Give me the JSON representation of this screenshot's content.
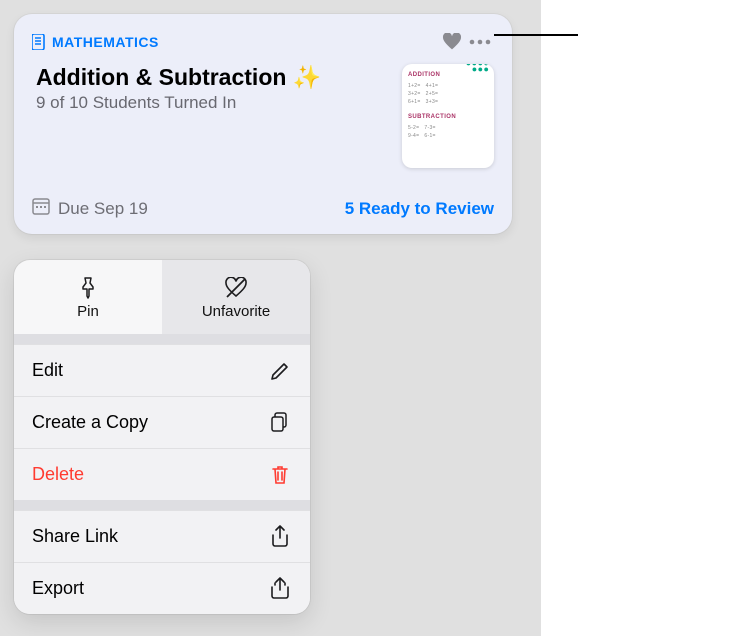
{
  "card": {
    "subject": "MATHEMATICS",
    "title": "Addition & Subtraction ✨",
    "subtitle": "9 of 10 Students Turned In",
    "due": "Due Sep 19",
    "review": "5 Ready to Review"
  },
  "thumbnail": {
    "heading1": "ADDITION",
    "heading2": "SUBTRACTION"
  },
  "menu": {
    "pin": "Pin",
    "unfavorite": "Unfavorite",
    "edit": "Edit",
    "copy": "Create a Copy",
    "delete": "Delete",
    "share": "Share Link",
    "export": "Export"
  },
  "colors": {
    "accent": "#007aff",
    "destructive": "#ff3b30"
  }
}
